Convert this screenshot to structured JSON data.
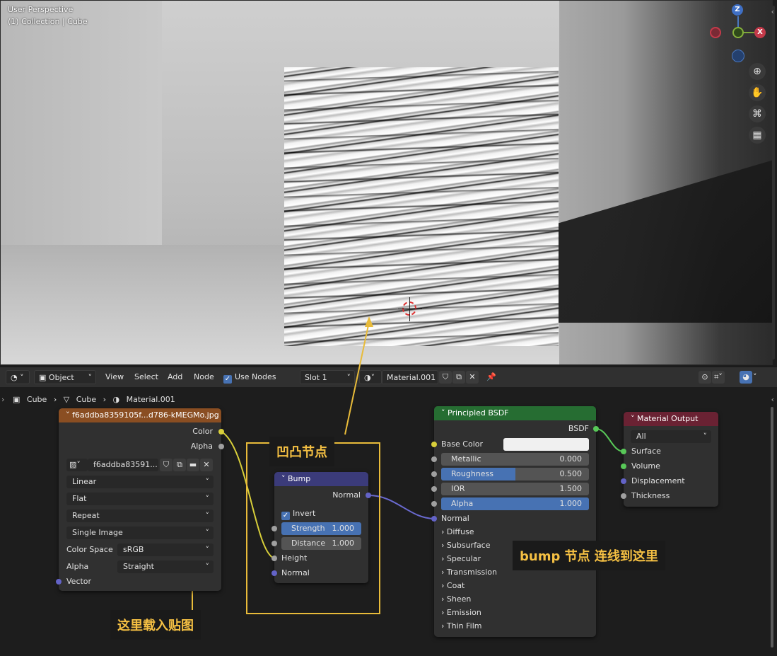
{
  "viewport": {
    "info_line1": "User Perspective",
    "info_line2": "(1) Collection | Cube",
    "gizmo": {
      "z": "Z",
      "x": "X"
    },
    "nav_icons": [
      "zoom-icon",
      "hand-icon",
      "camera-icon",
      "grid-icon"
    ]
  },
  "header": {
    "mode": "Object",
    "menus": [
      "View",
      "Select",
      "Add",
      "Node"
    ],
    "use_nodes_label": "Use Nodes",
    "use_nodes_checked": true,
    "slot": "Slot 1",
    "material": "Material.001"
  },
  "breadcrumb": {
    "object": "Cube",
    "mesh": "Cube",
    "material": "Material.001"
  },
  "image_node": {
    "title": "f6addba8359105f...d786-kMEGMo.jpg",
    "out_color": "Color",
    "out_alpha": "Alpha",
    "image_name": "f6addba83591...",
    "interpolation": "Linear",
    "projection": "Flat",
    "extension": "Repeat",
    "source": "Single Image",
    "color_space_label": "Color Space",
    "color_space": "sRGB",
    "alpha_label": "Alpha",
    "alpha": "Straight",
    "in_vector": "Vector",
    "header_color": "#8a4e22"
  },
  "bump_node": {
    "title": "Bump",
    "out_normal": "Normal",
    "invert_label": "Invert",
    "invert_checked": true,
    "strength_label": "Strength",
    "strength_value": "1.000",
    "distance_label": "Distance",
    "distance_value": "1.000",
    "in_height": "Height",
    "in_normal": "Normal",
    "header_color": "#3b3b7a"
  },
  "bsdf_node": {
    "title": "Principled BSDF",
    "out_bsdf": "BSDF",
    "base_color_label": "Base Color",
    "metallic_label": "Metallic",
    "metallic_value": "0.000",
    "roughness_label": "Roughness",
    "roughness_value": "0.500",
    "roughness_fill": 0.5,
    "ior_label": "IOR",
    "ior_value": "1.500",
    "alpha_label": "Alpha",
    "alpha_value": "1.000",
    "alpha_fill": 1.0,
    "normal_label": "Normal",
    "panels": [
      "Diffuse",
      "Subsurface",
      "Specular",
      "Transmission",
      "Coat",
      "Sheen",
      "Emission",
      "Thin Film"
    ],
    "header_color": "#266d32"
  },
  "output_node": {
    "title": "Material Output",
    "target": "All",
    "in_surface": "Surface",
    "in_volume": "Volume",
    "in_displacement": "Displacement",
    "in_thickness": "Thickness",
    "header_color": "#6a2233"
  },
  "annotations": {
    "bump_label": "凹凸节点",
    "connect_label": "bump 节点 连线到这里",
    "load_label": "这里载入贴图",
    "color": "#e8bb3a"
  }
}
